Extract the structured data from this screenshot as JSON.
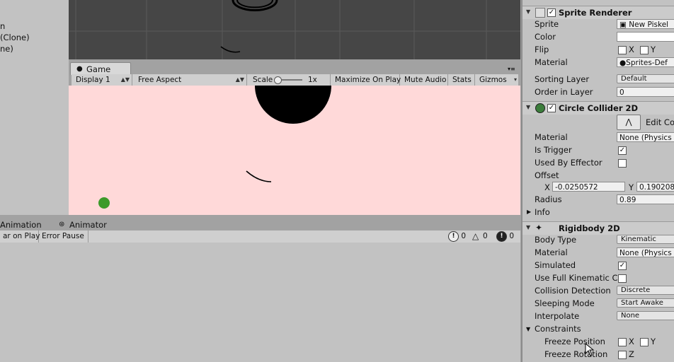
{
  "hierarchy": {
    "fragments": [
      "n",
      "(Clone)",
      "ne)"
    ]
  },
  "game": {
    "tab_label": "Game",
    "toolbar": {
      "display": "Display 1",
      "aspect": "Free Aspect",
      "scale_label": "Scale",
      "scale_value": "1x",
      "maximize": "Maximize On Play",
      "mute": "Mute Audio",
      "stats": "Stats",
      "gizmos": "Gizmos"
    },
    "background_color": "#ffd9d9"
  },
  "bottom": {
    "tabs": [
      "Animation",
      "Animator"
    ],
    "toolbar": {
      "clear_on_play": "ar on Play",
      "error_pause": "Error Pause"
    },
    "counts": {
      "info": "0",
      "warning": "0",
      "error": "0"
    }
  },
  "inspector": {
    "sprite_renderer": {
      "title": "Sprite Renderer",
      "sprite_label": "Sprite",
      "sprite_value": "New Piskel",
      "color_label": "Color",
      "flip_label": "Flip",
      "flip_x": "X",
      "flip_y": "Y",
      "material_label": "Material",
      "material_value": "Sprites-Def",
      "sorting_layer_label": "Sorting Layer",
      "sorting_layer_value": "Default",
      "order_label": "Order in Layer",
      "order_value": "0"
    },
    "circle_collider": {
      "title": "Circle Collider 2D",
      "edit_label": "Edit Co",
      "material_label": "Material",
      "material_value": "None (Physics",
      "is_trigger_label": "Is Trigger",
      "used_by_effector_label": "Used By Effector",
      "offset_label": "Offset",
      "offset_x_label": "X",
      "offset_x_value": "-0.0250572",
      "offset_y_label": "Y",
      "offset_y_value": "0.190208",
      "radius_label": "Radius",
      "radius_value": "0.89",
      "info_label": "Info"
    },
    "rigidbody": {
      "title": "Rigidbody 2D",
      "body_type_label": "Body Type",
      "body_type_value": "Kinematic",
      "material_label": "Material",
      "material_value": "None (Physics",
      "simulated_label": "Simulated",
      "full_kinematic_label": "Use Full Kinematic C",
      "collision_label": "Collision Detection",
      "collision_value": "Discrete",
      "sleeping_label": "Sleeping Mode",
      "sleeping_value": "Start Awake",
      "interpolate_label": "Interpolate",
      "interpolate_value": "None",
      "constraints_label": "Constraints",
      "freeze_position_label": "Freeze Position",
      "freeze_pos_x": "X",
      "freeze_pos_y": "Y",
      "freeze_rotation_label": "Freeze Rotation",
      "freeze_rot_z": "Z"
    }
  }
}
